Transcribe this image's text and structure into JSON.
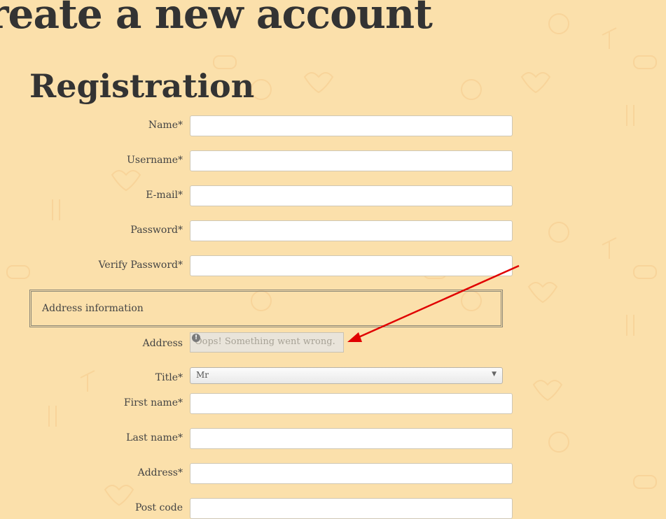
{
  "header": {
    "title": "reate a new account"
  },
  "form": {
    "section_title": "Registration",
    "fields": [
      {
        "label": "Name*",
        "value": ""
      },
      {
        "label": "Username*",
        "value": ""
      },
      {
        "label": "E-mail*",
        "value": ""
      },
      {
        "label": "Password*",
        "value": ""
      },
      {
        "label": "Verify Password*",
        "value": ""
      }
    ],
    "address_info": {
      "legend": "Address information",
      "address_label": "Address",
      "embed_error": "Oops! Something went wrong."
    },
    "title_field": {
      "label": "Title*",
      "selected": "Mr"
    },
    "more_fields": [
      {
        "label": "First name*",
        "value": ""
      },
      {
        "label": "Last name*",
        "value": ""
      },
      {
        "label": "Address*",
        "value": ""
      },
      {
        "label": "Post code",
        "value": ""
      }
    ]
  },
  "colors": {
    "background": "#fbe0ab",
    "arrow": "#e00000"
  }
}
